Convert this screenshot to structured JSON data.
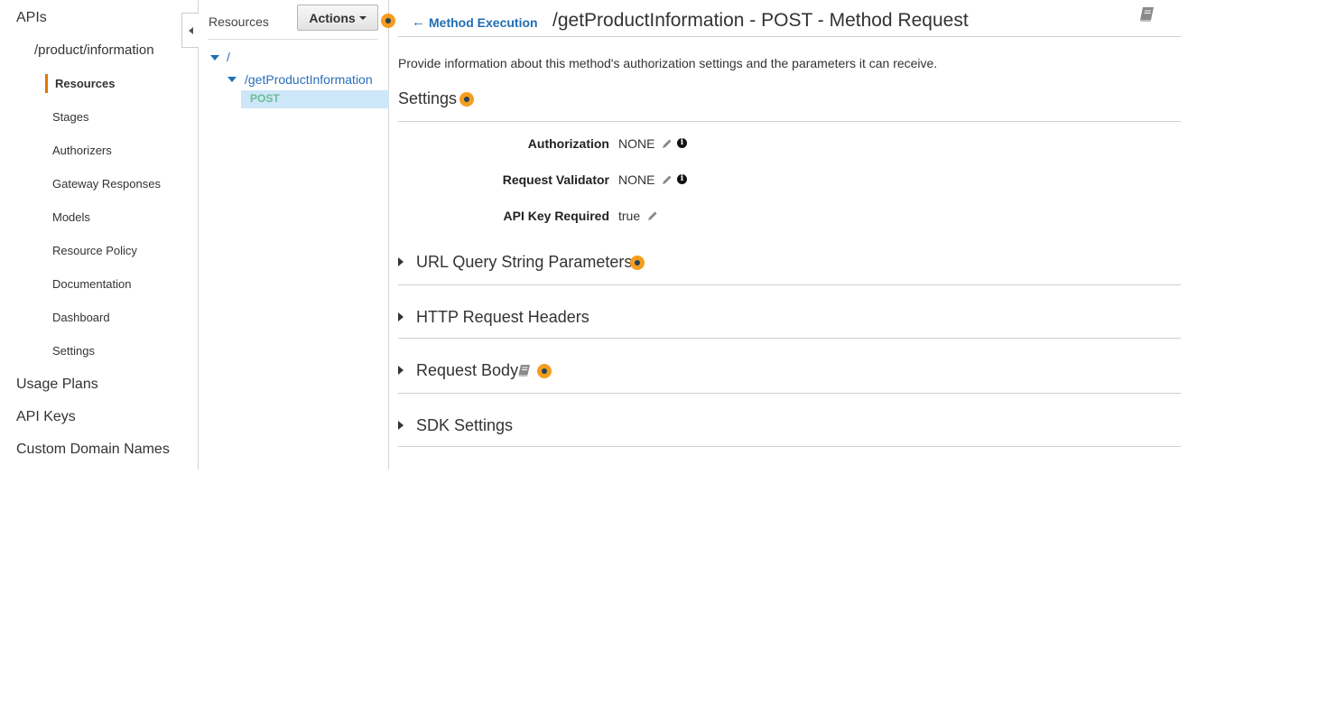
{
  "nav": {
    "apis_label": "APIs",
    "api_name": "/product/information",
    "sub_items": [
      {
        "label": "Resources",
        "active": true
      },
      {
        "label": "Stages"
      },
      {
        "label": "Authorizers"
      },
      {
        "label": "Gateway Responses"
      },
      {
        "label": "Models"
      },
      {
        "label": "Resource Policy"
      },
      {
        "label": "Documentation"
      },
      {
        "label": "Dashboard"
      },
      {
        "label": "Settings"
      }
    ],
    "bottom_items": [
      {
        "label": "Usage Plans"
      },
      {
        "label": "API Keys"
      },
      {
        "label": "Custom Domain Names"
      }
    ]
  },
  "resources": {
    "title": "Resources",
    "actions_label": "Actions",
    "tree": {
      "root": "/",
      "child": "/getProductInformation",
      "method": "POST"
    }
  },
  "main": {
    "back_link": "Method Execution",
    "title": "/getProductInformation - POST - Method Request",
    "description": "Provide information about this method's authorization settings and the parameters it can receive.",
    "settings_title": "Settings",
    "settings": [
      {
        "label": "Authorization",
        "value": "NONE"
      },
      {
        "label": "Request Validator",
        "value": "NONE"
      },
      {
        "label": "API Key Required",
        "value": "true"
      }
    ],
    "sections": [
      {
        "label": "URL Query String Parameters"
      },
      {
        "label": "HTTP Request Headers"
      },
      {
        "label": "Request Body"
      },
      {
        "label": "SDK Settings"
      }
    ]
  },
  "icons": {
    "help": "help-dot-icon",
    "book": "book-icon",
    "edit": "pencil-icon",
    "info": "info-icon",
    "back": "arrow-left-icon"
  },
  "colors": {
    "accent_orange": "#f59d1e",
    "active_bar": "#e07700",
    "link_blue": "#1f6fb5",
    "selected_row": "#cde7f8",
    "method_green": "#6bbf95"
  }
}
